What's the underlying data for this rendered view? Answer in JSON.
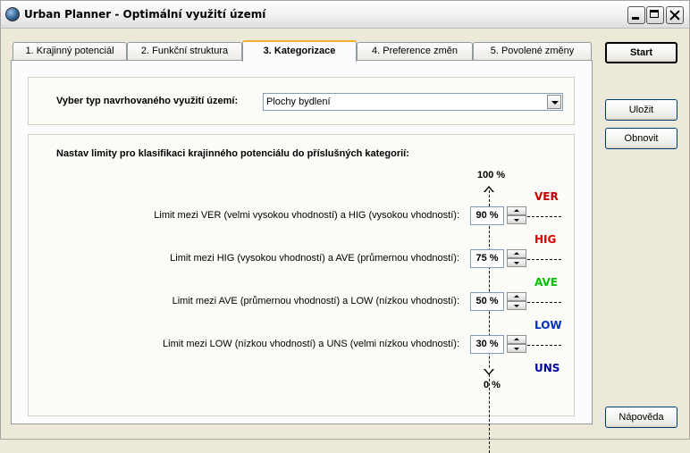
{
  "window": {
    "title": "Urban Planner - Optimální využití území"
  },
  "tabs": [
    {
      "label": "1. Krajinný potenciál"
    },
    {
      "label": "2. Funkční struktura"
    },
    {
      "label": "3. Kategorizace"
    },
    {
      "label": "4. Preference změn"
    },
    {
      "label": "5. Povolené změny"
    }
  ],
  "active_tab": 2,
  "land_use": {
    "label": "Vyber typ navrhovaného využití území:",
    "selected": "Plochy bydlení"
  },
  "limits": {
    "heading": "Nastav limity pro klasifikaci krajinného potenciálu do příslušných kategorií:",
    "top_label": "100 %",
    "bottom_label": "0 %",
    "rows": [
      {
        "label": "Limit mezi VER (velmi vysokou vhodností) a HIG (vysokou vhodností):",
        "value": "90 %"
      },
      {
        "label": "Limit mezi HIG (vysokou vhodností) a AVE (průmernou vhodností):",
        "value": "75 %"
      },
      {
        "label": "Limit mezi AVE (průmernou vhodností) a LOW (nízkou vhodností):",
        "value": "50 %"
      },
      {
        "label": "Limit mezi LOW (nízkou vhodností) a UNS (velmi nízkou vhodností):",
        "value": "30 %"
      }
    ],
    "categories": [
      {
        "code": "VER",
        "color": "#c00000"
      },
      {
        "code": "HIG",
        "color": "#e00000"
      },
      {
        "code": "AVE",
        "color": "#00c000"
      },
      {
        "code": "LOW",
        "color": "#0030c0"
      },
      {
        "code": "UNS",
        "color": "#0000a0"
      }
    ]
  },
  "buttons": {
    "start": "Start",
    "save": "Uložit",
    "refresh": "Obnovit",
    "help": "Nápověda"
  }
}
